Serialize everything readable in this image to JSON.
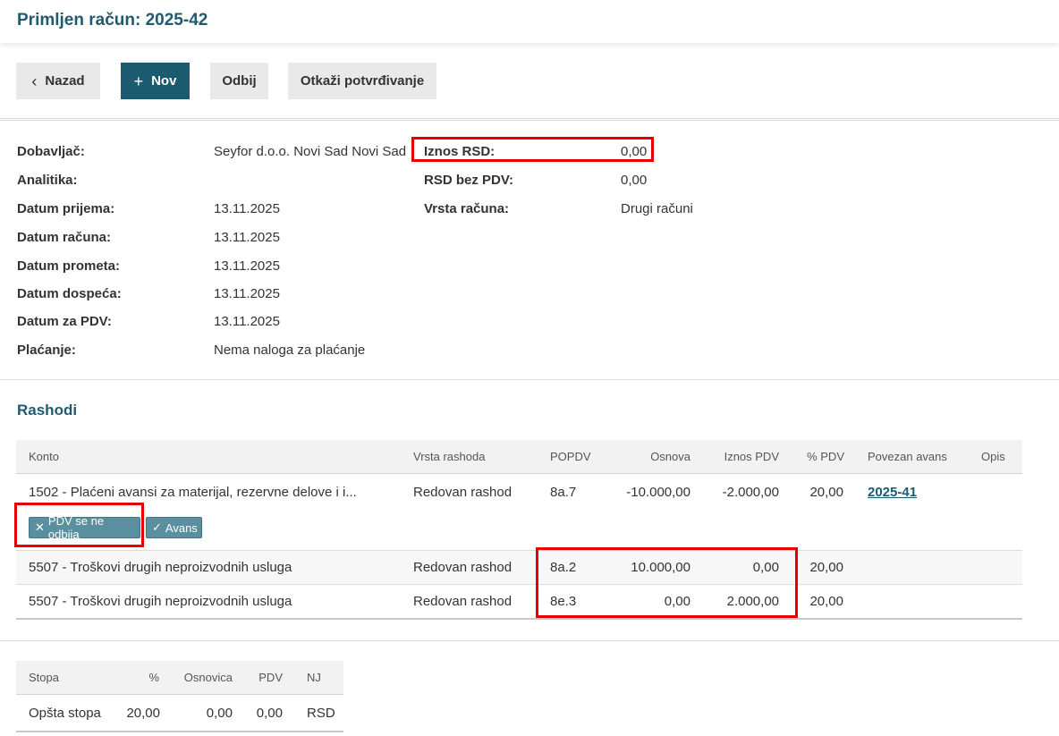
{
  "header": {
    "title": "Primljen račun: 2025-42"
  },
  "toolbar": {
    "back_label": "Nazad",
    "new_label": "Nov",
    "reject_label": "Odbij",
    "cancel_confirm_label": "Otkaži potvrđivanje"
  },
  "details": {
    "supplier_label": "Dobavljač:",
    "supplier_value": "Seyfor d.o.o. Novi Sad Novi Sad",
    "analytics_label": "Analitika:",
    "receipt_date_label": "Datum prijema:",
    "receipt_date_value": "13.11.2025",
    "invoice_date_label": "Datum računa:",
    "invoice_date_value": "13.11.2025",
    "turnover_date_label": "Datum prometa:",
    "turnover_date_value": "13.11.2025",
    "due_date_label": "Datum dospeća:",
    "due_date_value": "13.11.2025",
    "vat_date_label": "Datum za PDV:",
    "vat_date_value": "13.11.2025",
    "payment_label": "Plaćanje:",
    "payment_value": "Nema naloga za plaćanje",
    "amount_label": "Iznos RSD:",
    "amount_value": "0,00",
    "net_label": "RSD bez PDV:",
    "net_value": "0,00",
    "type_label": "Vrsta računa:",
    "type_value": "Drugi računi"
  },
  "expenses": {
    "title": "Rashodi",
    "columns": [
      "Konto",
      "Vrsta rashoda",
      "POPDV",
      "Osnova",
      "Iznos PDV",
      "% PDV",
      "Povezan avans",
      "Opis"
    ],
    "rows": [
      {
        "konto": "1502 - Plaćeni avansi za materijal, rezervne delove i i...",
        "vrsta": "Redovan rashod",
        "popdv": "8a.7",
        "osnova": "-10.000,00",
        "pdv": "-2.000,00",
        "pct": "20,00",
        "avans": "2025-41",
        "opis": ""
      },
      {
        "konto": "5507 - Troškovi drugih neproizvodnih usluga",
        "vrsta": "Redovan rashod",
        "popdv": "8a.2",
        "osnova": "10.000,00",
        "pdv": "0,00",
        "pct": "20,00",
        "avans": "",
        "opis": ""
      },
      {
        "konto": "5507 - Troškovi drugih neproizvodnih usluga",
        "vrsta": "Redovan rashod",
        "popdv": "8e.3",
        "osnova": "0,00",
        "pdv": "2.000,00",
        "pct": "20,00",
        "avans": "",
        "opis": ""
      }
    ],
    "tags": {
      "no_deduct": "PDV se ne odbija",
      "advance": "Avans"
    }
  },
  "tax_summary": {
    "columns": [
      "Stopa",
      "%",
      "Osnovica",
      "PDV",
      "NJ"
    ],
    "rows": [
      {
        "stopa": "Opšta stopa",
        "pct": "20,00",
        "osnovica": "0,00",
        "pdv": "0,00",
        "nj": "RSD"
      }
    ]
  },
  "colors": {
    "accent": "#1b5b70",
    "title": "#1f5a6e",
    "highlight": "#e60000",
    "tag": "#5a8fa0"
  },
  "icons": {
    "back": "chevron-left-icon",
    "new": "plus-icon",
    "no_deduct": "x-icon",
    "advance": "check-icon"
  }
}
